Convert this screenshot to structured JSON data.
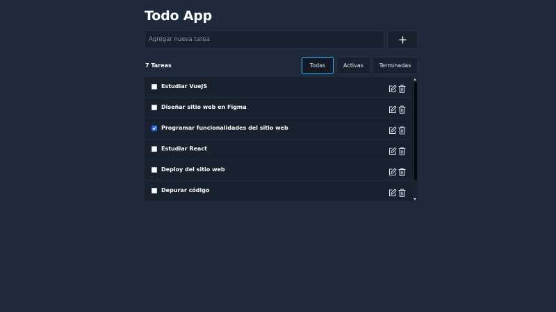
{
  "app": {
    "title": "Todo App"
  },
  "new_task": {
    "placeholder": "Agregar nueva tarea",
    "value": "",
    "add_icon": "plus-icon"
  },
  "summary": {
    "count_label": "7 Tareas"
  },
  "filters": {
    "items": [
      {
        "label": "Todas",
        "active": true
      },
      {
        "label": "Activas",
        "active": false
      },
      {
        "label": "Terminadas",
        "active": false
      }
    ]
  },
  "tasks": {
    "items": [
      {
        "text": "Estudiar VueJS",
        "done": false
      },
      {
        "text": "Diseñar sitio web en Figma",
        "done": false
      },
      {
        "text": "Programar funcionalidades del sitio web",
        "done": true
      },
      {
        "text": "Estudiar React",
        "done": false
      },
      {
        "text": "Deploy del sitio web",
        "done": false
      },
      {
        "text": "Depurar código",
        "done": false
      }
    ],
    "edit_icon": "edit-icon",
    "delete_icon": "trash-icon"
  },
  "colors": {
    "background": "#1e293b",
    "panel": "#18212e",
    "active_filter_border": "#38bdf8",
    "checked": "#2563eb",
    "text": "#ffffff"
  }
}
